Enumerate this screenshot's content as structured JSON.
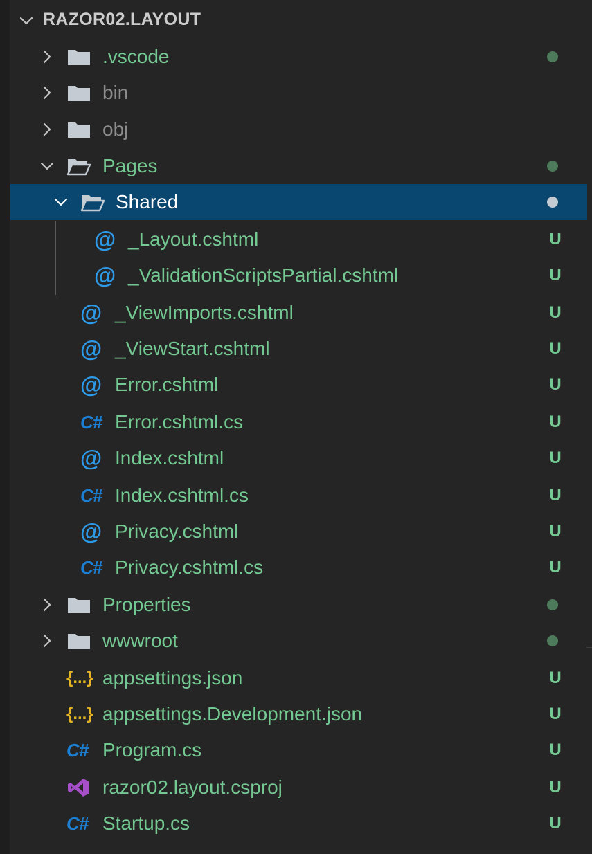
{
  "explorer": {
    "title": "RAZOR02.LAYOUT",
    "rows": [
      {
        "name": "tree-folder-vscode",
        "label": ".vscode",
        "kind": "folder",
        "expanded": false,
        "status": "dot"
      },
      {
        "name": "tree-folder-bin",
        "label": "bin",
        "kind": "folder",
        "expanded": false,
        "status": ""
      },
      {
        "name": "tree-folder-obj",
        "label": "obj",
        "kind": "folder",
        "expanded": false,
        "status": ""
      },
      {
        "name": "tree-folder-pages",
        "label": "Pages",
        "kind": "folder",
        "expanded": true,
        "status": "dot"
      },
      {
        "name": "tree-folder-shared",
        "label": "Shared",
        "kind": "folder",
        "expanded": true,
        "status": "dot",
        "selected": true
      },
      {
        "name": "tree-file-layout",
        "label": "_Layout.cshtml",
        "kind": "razor",
        "status": "U"
      },
      {
        "name": "tree-file-validation",
        "label": "_ValidationScriptsPartial.cshtml",
        "kind": "razor",
        "status": "U"
      },
      {
        "name": "tree-file-viewimports",
        "label": "_ViewImports.cshtml",
        "kind": "razor",
        "status": "U"
      },
      {
        "name": "tree-file-viewstart",
        "label": "_ViewStart.cshtml",
        "kind": "razor",
        "status": "U"
      },
      {
        "name": "tree-file-error",
        "label": "Error.cshtml",
        "kind": "razor",
        "status": "U"
      },
      {
        "name": "tree-file-error-cs",
        "label": "Error.cshtml.cs",
        "kind": "csharp",
        "status": "U"
      },
      {
        "name": "tree-file-index",
        "label": "Index.cshtml",
        "kind": "razor",
        "status": "U"
      },
      {
        "name": "tree-file-index-cs",
        "label": "Index.cshtml.cs",
        "kind": "csharp",
        "status": "U"
      },
      {
        "name": "tree-file-privacy",
        "label": "Privacy.cshtml",
        "kind": "razor",
        "status": "U"
      },
      {
        "name": "tree-file-privacy-cs",
        "label": "Privacy.cshtml.cs",
        "kind": "csharp",
        "status": "U"
      },
      {
        "name": "tree-folder-properties",
        "label": "Properties",
        "kind": "folder",
        "expanded": false,
        "status": "dot"
      },
      {
        "name": "tree-folder-wwwroot",
        "label": "wwwroot",
        "kind": "folder",
        "expanded": false,
        "status": "dot"
      },
      {
        "name": "tree-file-appsettings",
        "label": "appsettings.json",
        "kind": "json",
        "status": "U"
      },
      {
        "name": "tree-file-appsettings-dev",
        "label": "appsettings.Development.json",
        "kind": "json",
        "status": "U"
      },
      {
        "name": "tree-file-program",
        "label": "Program.cs",
        "kind": "csharp",
        "status": "U"
      },
      {
        "name": "tree-file-csproj",
        "label": "razor02.layout.csproj",
        "kind": "csproj",
        "status": "U"
      },
      {
        "name": "tree-file-startup",
        "label": "Startup.cs",
        "kind": "csharp",
        "status": "U"
      }
    ]
  },
  "glyphs": {
    "razor": "@",
    "csharp": "C#",
    "json": "{...}"
  },
  "colors": {
    "untracked_green": "#73c991",
    "ignored_gray": "#8c8c8c",
    "selected_bg": "#094771",
    "selected_text": "#ffffff",
    "dot_green": "#4d7a5a",
    "dot_selected": "#c5cbd3",
    "folder_icon": "#c5cbd3",
    "chevron": "#c5c5c5",
    "razor_icon": "#2d9ae8",
    "csharp_icon": "#1b7fd4",
    "json_icon": "#e6b422",
    "csproj_icon": "#a74ec9"
  }
}
